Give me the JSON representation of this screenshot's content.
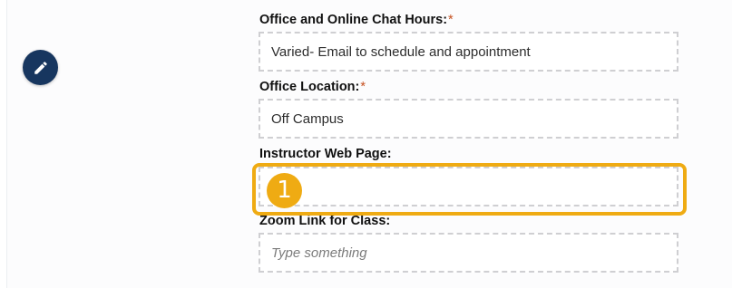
{
  "edit_button": {
    "icon": "pencil-icon"
  },
  "fields": {
    "office_hours": {
      "label": "Office and Online Chat Hours:",
      "required_mark": "*",
      "value": "Varied- Email to schedule and appointment"
    },
    "office_location": {
      "label": "Office Location:",
      "required_mark": "*",
      "value": "Off Campus"
    },
    "instructor_web_page": {
      "label": "Instructor Web Page:",
      "value": ""
    },
    "zoom_link": {
      "label": "Zoom Link for Class:",
      "placeholder": "Type something",
      "value": ""
    }
  },
  "annotation": {
    "marker_number": "1",
    "color": "#efab13"
  },
  "colors": {
    "edit_button_bg": "#17365f",
    "required_mark": "#c6501f",
    "field_border": "#cfcfd2"
  }
}
